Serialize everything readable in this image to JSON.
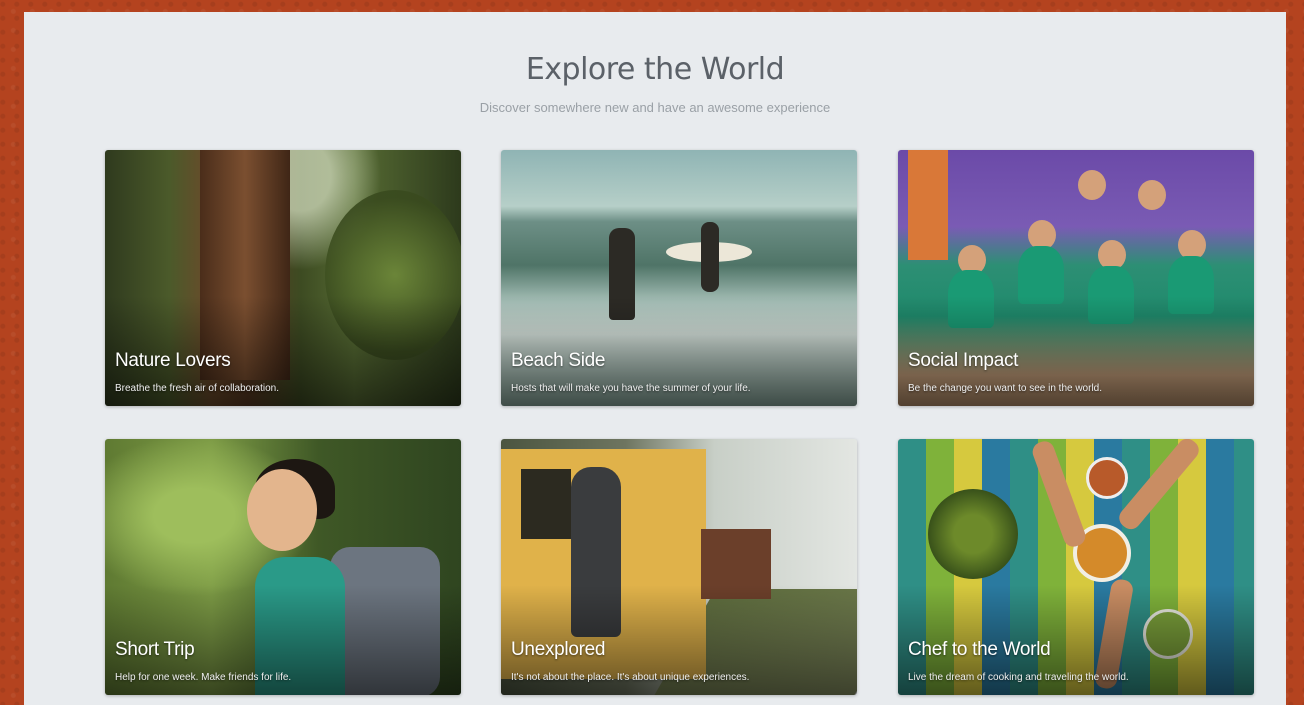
{
  "page": {
    "title": "Explore the World",
    "subtitle": "Discover somewhere new and have an awesome experience"
  },
  "cards": [
    {
      "title": "Nature Lovers",
      "description": "Breathe the fresh air of collaboration."
    },
    {
      "title": "Beach Side",
      "description": "Hosts that will make you have the summer of your life."
    },
    {
      "title": "Social Impact",
      "description": "Be the change you want to see in the world."
    },
    {
      "title": "Short Trip",
      "description": "Help for one week. Make friends for life."
    },
    {
      "title": "Unexplored",
      "description": "It's not about the place. It's about unique experiences."
    },
    {
      "title": "Chef to the World",
      "description": "Live the dream of cooking and traveling the world."
    }
  ],
  "colors": {
    "background": "#b4431f",
    "panel": "#e8ebee",
    "heading": "#5b6168",
    "subheading": "#9aa0a6"
  }
}
